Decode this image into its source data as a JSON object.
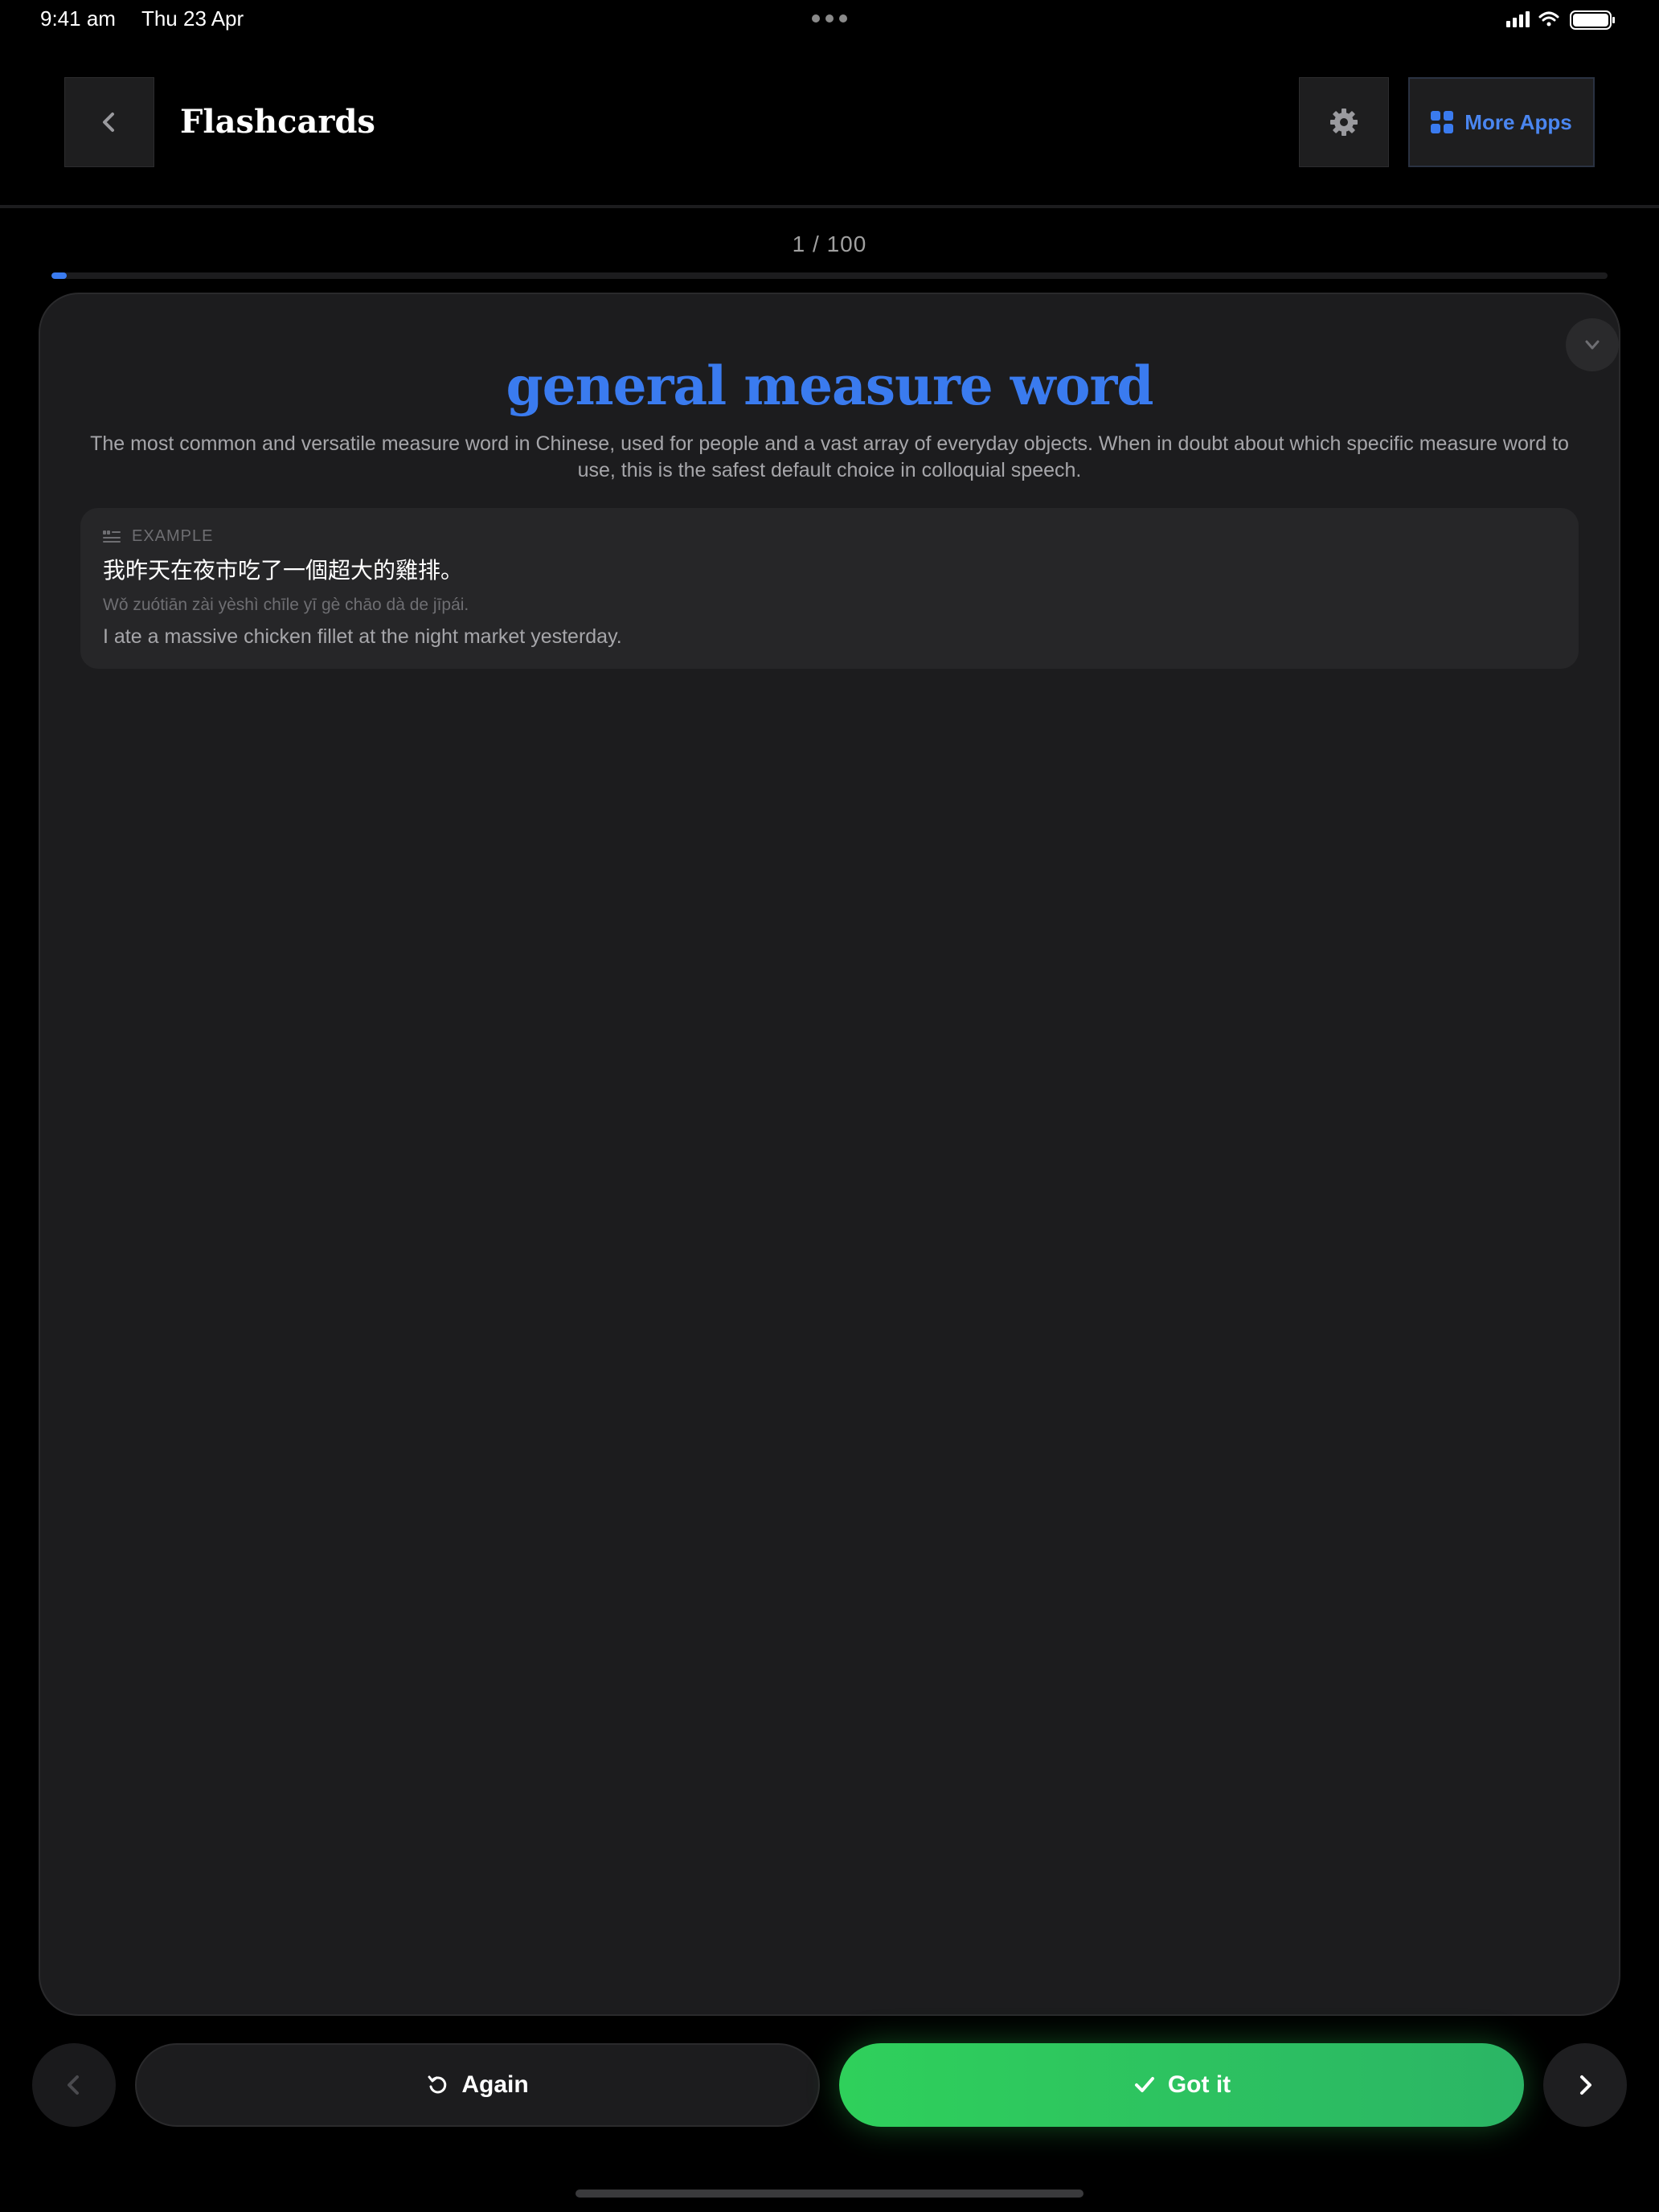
{
  "status_bar": {
    "time": "9:41 am",
    "date": "Thu 23 Apr"
  },
  "header": {
    "title": "Flashcards",
    "back_icon": "chevron-left-icon",
    "settings_icon": "gear-icon",
    "more_apps_label": "More Apps",
    "more_apps_icon": "grid-icon"
  },
  "progress": {
    "counter": "1 / 100",
    "current": 1,
    "total": 100,
    "fraction": 0.01
  },
  "card": {
    "term": "general measure word",
    "definition": "The most common and versatile measure word in Chinese, used for people and a vast array of everyday objects. When in doubt about which specific measure word to use, this is the safest default choice in colloquial speech.",
    "example": {
      "label": "EXAMPLE",
      "chinese": "我昨天在夜市吃了一個超大的雞排。",
      "pinyin": "Wǒ zuótiān zài yèshì chīle yī gè chāo dà de jīpái.",
      "english": "I ate a massive chicken fillet at the night market yesterday."
    },
    "collapse_icon": "chevron-down-icon"
  },
  "controls": {
    "again_label": "Again",
    "again_icon": "rotate-ccw-icon",
    "got_it_label": "Got it",
    "got_it_icon": "check-icon",
    "prev_icon": "chevron-left-icon",
    "next_icon": "chevron-right-icon"
  },
  "colors": {
    "accent": "#3a7bef",
    "success": "#30d158",
    "background": "#000000",
    "card": "#1c1c1e"
  }
}
